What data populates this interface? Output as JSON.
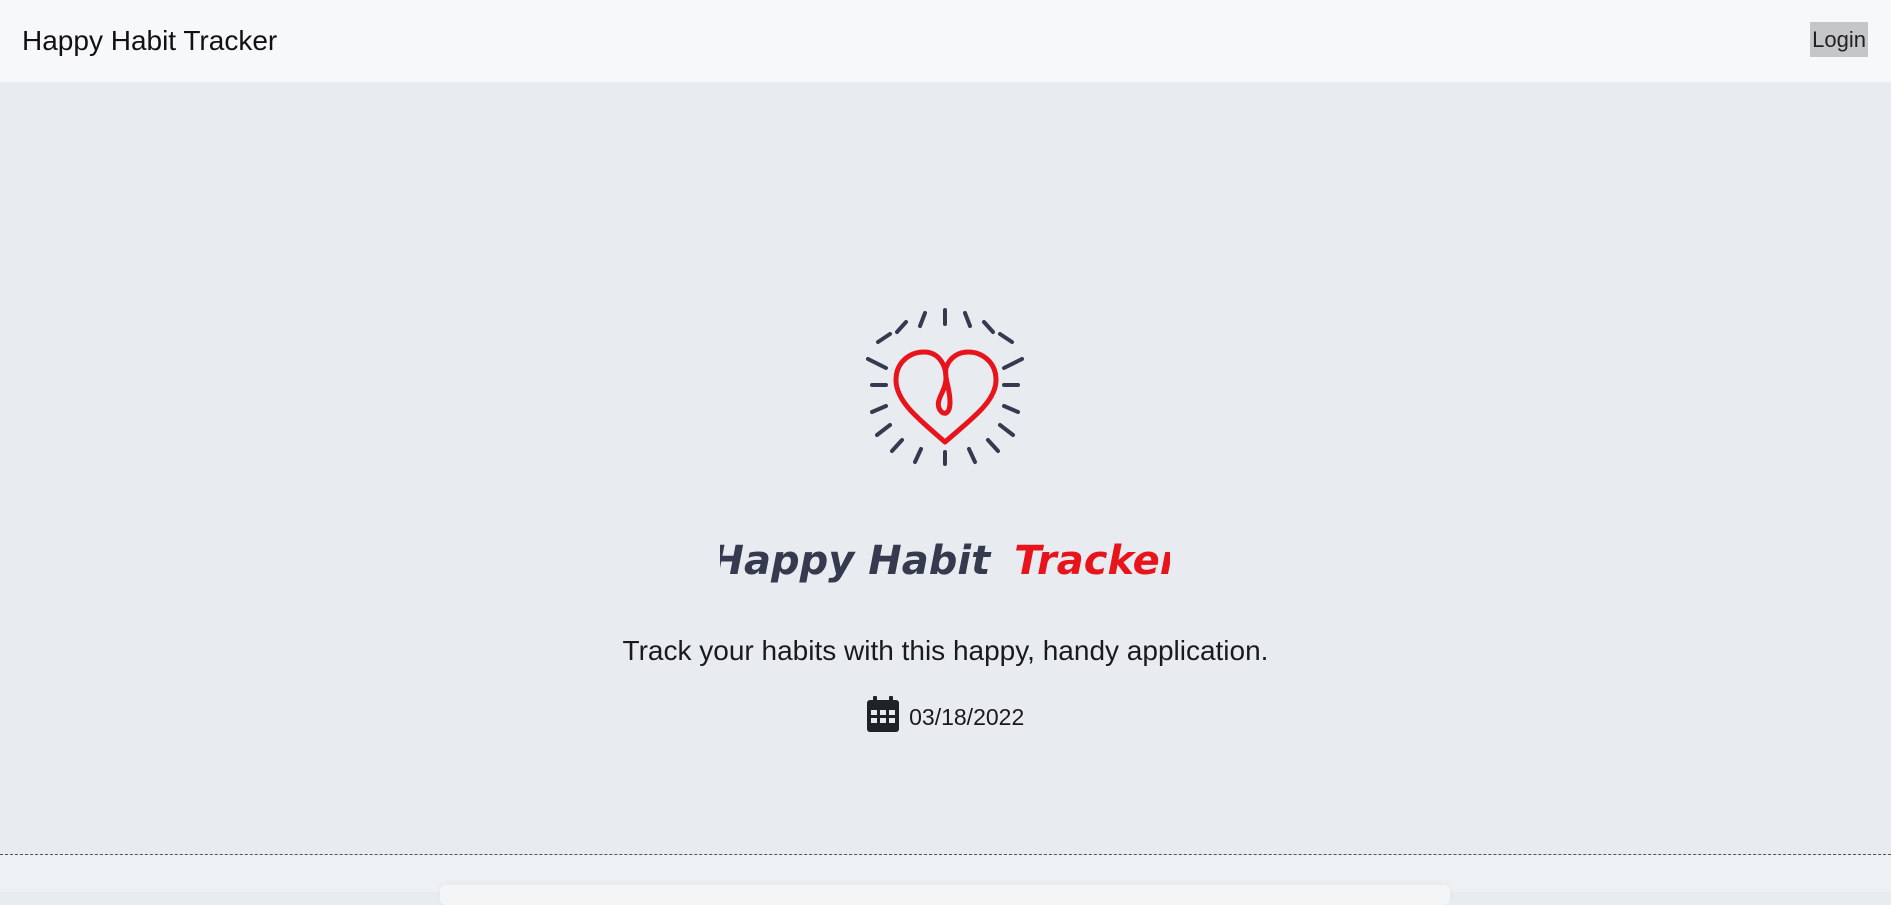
{
  "navbar": {
    "brand": "Happy Habit Tracker",
    "login_label": "Login"
  },
  "logo": {
    "word_dark": "Happy Habit",
    "word_accent": "Tracker",
    "icon": "heart-sunburst-logo",
    "colors": {
      "dark": "#353a4e",
      "accent": "#e8141c"
    }
  },
  "main": {
    "tagline": "Track your habits with this happy, handy application.",
    "date_icon": "calendar-icon",
    "date": "03/18/2022"
  }
}
